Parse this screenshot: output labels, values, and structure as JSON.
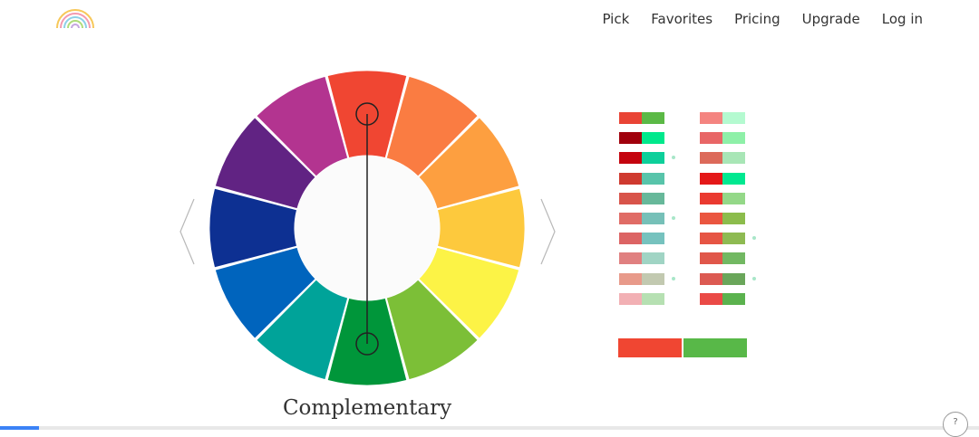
{
  "logo": {
    "icon": "rainbow-icon"
  },
  "nav": {
    "items": [
      {
        "label": "Pick"
      },
      {
        "label": "Favorites"
      },
      {
        "label": "Pricing"
      },
      {
        "label": "Upgrade"
      },
      {
        "label": "Log in"
      }
    ]
  },
  "wheel": {
    "segments": [
      "#f04632",
      "#fa7c42",
      "#fd9f40",
      "#fdc93d",
      "#fcf346",
      "#7cbf37",
      "#00963a",
      "#00a399",
      "#0064bd",
      "#0d3092",
      "#612383",
      "#b33490"
    ],
    "center_fill": "#fbfbfb",
    "handle_color": "#222222",
    "selected_index_top": 0,
    "selected_index_bottom": 6
  },
  "scheme_name": "Complementary",
  "palette": {
    "column1": [
      {
        "a": "#e94435",
        "b": "#5bb946",
        "dot": false
      },
      {
        "a": "#a0000c",
        "b": "#00e88c",
        "dot": false
      },
      {
        "a": "#c4040e",
        "b": "#0dcf9a",
        "dot": true
      },
      {
        "a": "#cf3a2f",
        "b": "#58c4aa",
        "dot": false
      },
      {
        "a": "#d8544a",
        "b": "#67b89a",
        "dot": false
      },
      {
        "a": "#e06c66",
        "b": "#76c0b8",
        "dot": true
      },
      {
        "a": "#dc6464",
        "b": "#76c2be",
        "dot": false
      },
      {
        "a": "#e08080",
        "b": "#a0d4c4",
        "dot": false
      },
      {
        "a": "#e89a8a",
        "b": "#c2c9b0",
        "dot": true
      },
      {
        "a": "#f2b0b4",
        "b": "#b6e0b2",
        "dot": false
      }
    ],
    "column2": [
      {
        "a": "#f48480",
        "b": "#b4fad0",
        "dot": false
      },
      {
        "a": "#e86666",
        "b": "#8ef0a8",
        "dot": false
      },
      {
        "a": "#dc6a5a",
        "b": "#a8e6b6",
        "dot": false
      },
      {
        "a": "#e41818",
        "b": "#00e890",
        "dot": false
      },
      {
        "a": "#ea3a30",
        "b": "#94d888",
        "dot": false
      },
      {
        "a": "#ea5640",
        "b": "#8cbc4c",
        "dot": false
      },
      {
        "a": "#e65544",
        "b": "#8eba52",
        "dot": true
      },
      {
        "a": "#e0574a",
        "b": "#72b862",
        "dot": false
      },
      {
        "a": "#dc5a52",
        "b": "#6aa65a",
        "dot": true
      },
      {
        "a": "#ea4a46",
        "b": "#5bb24e",
        "dot": false
      }
    ]
  },
  "selected_pair": {
    "a": "#f04632",
    "b": "#58b848"
  },
  "progress": {
    "fraction": 0.04,
    "color": "#3b82f6"
  },
  "corner_button": {
    "icon": "help-icon",
    "label": "?"
  }
}
